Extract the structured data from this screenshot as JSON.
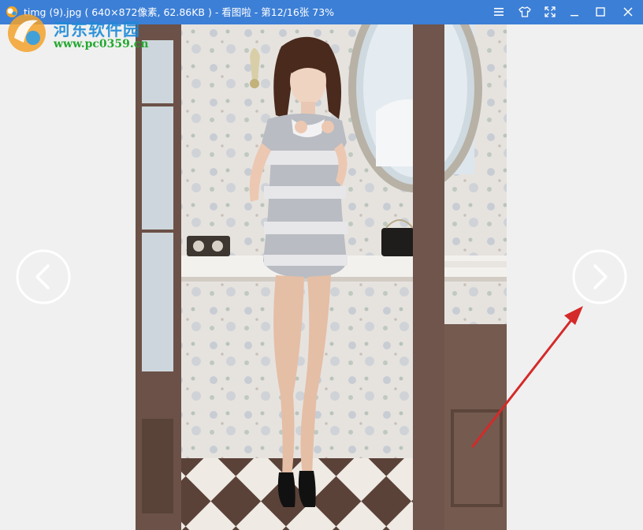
{
  "window": {
    "title": "timg (9).jpg ( 640×872像素, 62.86KB ) - 看图啦 - 第12/16张 73%"
  },
  "watermark": {
    "name": "河东软件园",
    "url": "www.pc0359.cn"
  },
  "colors": {
    "titlebar": "#3c7fd6",
    "window_bg": "#f0f0f0",
    "annotation_arrow": "#d42a2a"
  },
  "icons": {
    "menu": "menu-icon",
    "skin": "shirt-icon",
    "fullscreen": "expand-icon",
    "minimize": "minimize-icon",
    "maximize": "maximize-icon",
    "close": "close-icon",
    "previous": "chevron-left-icon",
    "next": "chevron-right-icon"
  }
}
